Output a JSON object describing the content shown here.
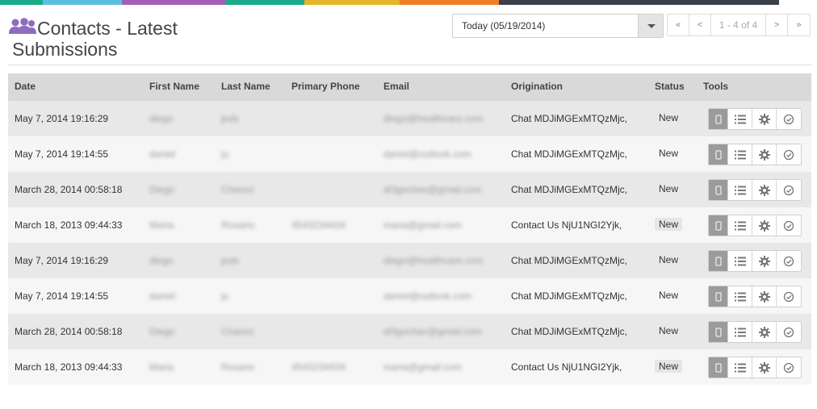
{
  "colors": {
    "strip": [
      "#1aab8a",
      "#5bc0de",
      "#a55eb8",
      "#1aab8a",
      "#e4b429",
      "#ef7f23",
      "#3a3f4b",
      "#3a3f4b"
    ],
    "accent_icon": "#8e6cc0"
  },
  "header": {
    "title_line1": "Contacts - Latest",
    "title_line2": "Submissions",
    "date_filter_value": "Today (05/19/2014)"
  },
  "pager": {
    "first": "«",
    "prev": "<",
    "info": "1 - 4 of 4",
    "next": ">",
    "last": "»"
  },
  "table": {
    "columns": [
      "Date",
      "First Name",
      "Last Name",
      "Primary Phone",
      "Email",
      "Origination",
      "Status",
      "Tools"
    ],
    "rows": [
      {
        "date": "May 7, 2014 19:16:29",
        "first": "diego",
        "last": "jeds",
        "phone": "",
        "email": "diego@healthcare.com",
        "origination": "Chat  MDJiMGExMTQzMjc,",
        "status": "New"
      },
      {
        "date": "May 7, 2014 19:14:55",
        "first": "daniel",
        "last": "ju",
        "phone": "",
        "email": "daniel@outlook.com",
        "origination": "Chat  MDJiMGExMTQzMjc,",
        "status": "New"
      },
      {
        "date": "March 28, 2014 00:58:18",
        "first": "Diego",
        "last": "Chavez",
        "phone": "",
        "email": "dl3gochav@gmail.com",
        "origination": "Chat  MDJiMGExMTQzMjc,",
        "status": "New"
      },
      {
        "date": "March 18, 2013 09:44:33",
        "first": "Maria",
        "last": "Rosario",
        "phone": "4543234434",
        "email": "maria@gmail.com",
        "origination": "Contact Us  NjU1NGI2Yjk,",
        "status": "New"
      },
      {
        "date": "May 7, 2014 19:16:29",
        "first": "diego",
        "last": "jeds",
        "phone": "",
        "email": "diego@healthcare.com",
        "origination": "Chat  MDJiMGExMTQzMjc,",
        "status": "New"
      },
      {
        "date": "May 7, 2014 19:14:55",
        "first": "daniel",
        "last": "ju",
        "phone": "",
        "email": "daniel@outlook.com",
        "origination": "Chat  MDJiMGExMTQzMjc,",
        "status": "New"
      },
      {
        "date": "March 28, 2014 00:58:18",
        "first": "Diego",
        "last": "Chavez",
        "phone": "",
        "email": "dl3gochav@gmail.com",
        "origination": "Chat  MDJiMGExMTQzMjc,",
        "status": "New"
      },
      {
        "date": "March 18, 2013 09:44:33",
        "first": "Maria",
        "last": "Rosario",
        "phone": "4543234434",
        "email": "maria@gmail.com",
        "origination": "Contact Us  NjU1NGI2Yjk,",
        "status": "New"
      }
    ],
    "tools": [
      "mobile-icon",
      "list-icon",
      "gear-icon",
      "clock-icon"
    ]
  }
}
